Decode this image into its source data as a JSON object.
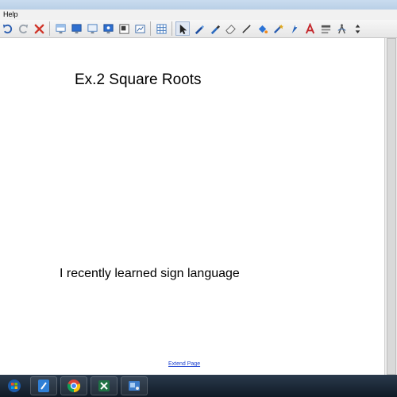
{
  "menubar": {
    "help_label": "Help"
  },
  "toolbar": {
    "tools": [
      "undo-icon",
      "redo-icon",
      "delete-icon",
      "screen-shade-icon",
      "display-icon",
      "monitor-icon",
      "record-icon",
      "image-icon",
      "capture-icon",
      "table-icon",
      "select-arrow-icon",
      "pen-icon",
      "highlighter-icon",
      "eraser-icon",
      "line-icon",
      "fill-icon",
      "magic-pen-icon",
      "creative-pen-icon",
      "text-icon",
      "font-format-icon",
      "compass-icon",
      "more-icon"
    ]
  },
  "canvas": {
    "title": "Ex.2 Square Roots",
    "body_text": "I recently learned sign language",
    "extend_link": "Extend Page"
  },
  "taskbar": {
    "items": [
      "start-icon",
      "notebook-app-icon",
      "chrome-icon",
      "excel-icon",
      "recorder-app-icon"
    ]
  },
  "colors": {
    "link": "#1a3fd0",
    "taskbar": "#16202c",
    "toolbar": "#eeeeee"
  }
}
